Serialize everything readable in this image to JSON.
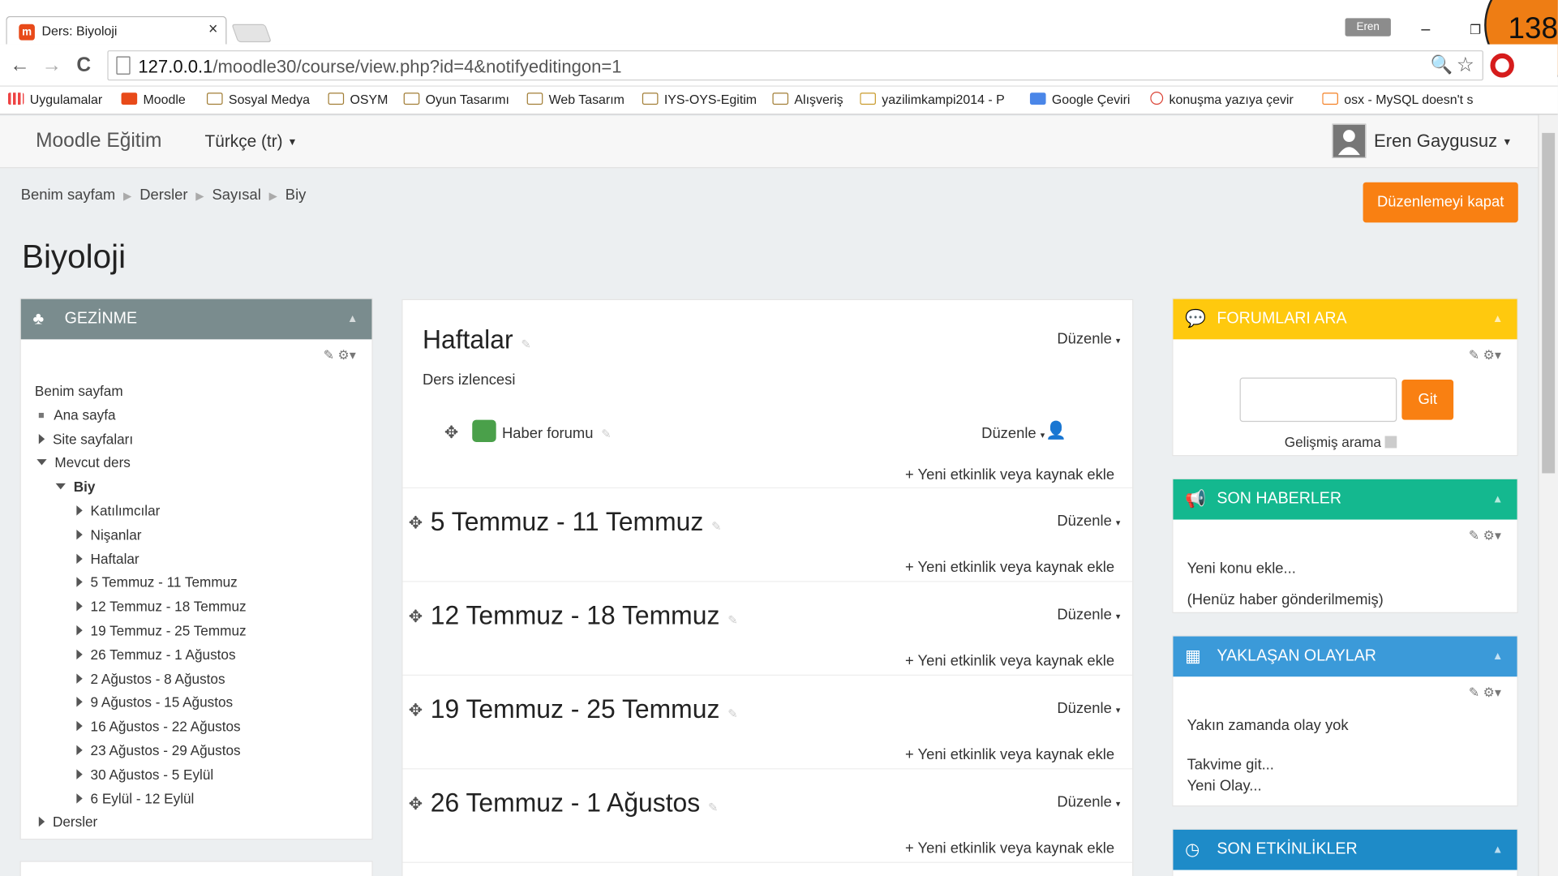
{
  "browser": {
    "tab_title": "Ders: Biyoloji",
    "tab_close": "×",
    "user_chip": "Eren",
    "minimize": "–",
    "restore": "❐",
    "overlay_badge": "138",
    "back": "←",
    "forward": "→",
    "reload": "C",
    "url_host": "127.0.0.1",
    "url_path": "/moodle30/course/view.php?id=4&notifyeditingon=1",
    "zoom_icon": "🔍",
    "star_icon": "☆",
    "bookmarks": [
      "Uygulamalar",
      "Moodle",
      "Sosyal Medya",
      "OSYM",
      "Oyun Tasarımı",
      "Web Tasarım",
      "IYS-OYS-Egitim",
      "Alışveriş",
      "yazilimkampi2014 - P",
      "Google Çeviri",
      "konuşma yazıya çevir",
      "osx - MySQL doesn't s"
    ]
  },
  "header": {
    "brand": "Moodle Eğitim",
    "language": "Türkçe (tr)",
    "user": "Eren Gaygusuz"
  },
  "breadcrumb": [
    "Benim sayfam",
    "Dersler",
    "Sayısal",
    "Biy"
  ],
  "edit_button": "Düzenlemeyi kapat",
  "page_title": "Biyoloji",
  "nav_block": {
    "title": "GEZİNME",
    "items": [
      "Benim sayfam",
      "Ana sayfa",
      "Site sayfaları",
      "Mevcut ders",
      "Biy",
      "Katılımcılar",
      "Nişanlar",
      "Haftalar",
      "5 Temmuz - 11 Temmuz",
      "12 Temmuz - 18 Temmuz",
      "19 Temmuz - 25 Temmuz",
      "26 Temmuz - 1 Ağustos",
      "2 Ağustos - 8 Ağustos",
      "9 Ağustos - 15 Ağustos",
      "16 Ağustos - 22 Ağustos",
      "23 Ağustos - 29 Ağustos",
      "30 Ağustos - 5 Eylül",
      "6 Eylül - 12 Eylül",
      "Dersler"
    ]
  },
  "main": {
    "edit": "Düzenle",
    "add": "Yeni etkinlik veya kaynak ekle",
    "sec0_title": "Haftalar",
    "sec0_summary": "Ders izlencesi",
    "forum": "Haber forumu",
    "sections": [
      "5 Temmuz - 11 Temmuz",
      "12 Temmuz - 18 Temmuz",
      "19 Temmuz - 25 Temmuz",
      "26 Temmuz - 1 Ağustos"
    ]
  },
  "forum_search": {
    "title": "FORUMLARI ARA",
    "button": "Git",
    "advanced": "Gelişmiş arama"
  },
  "news": {
    "title": "SON HABERLER",
    "add": "Yeni konu ekle...",
    "empty": "(Henüz haber gönderilmemiş)"
  },
  "events": {
    "title": "YAKLAŞAN OLAYLAR",
    "none": "Yakın zamanda olay yok",
    "calendar": "Takvime git...",
    "new": "Yeni Olay..."
  },
  "activity": {
    "title": "SON ETKİNLİKLER"
  },
  "colors": {
    "nav": "#7a8c8e",
    "forum": "#ffc90e",
    "news": "#14b88f",
    "events": "#3b9ad9",
    "activity": "#1e8bc8",
    "accent": "#f98012"
  }
}
